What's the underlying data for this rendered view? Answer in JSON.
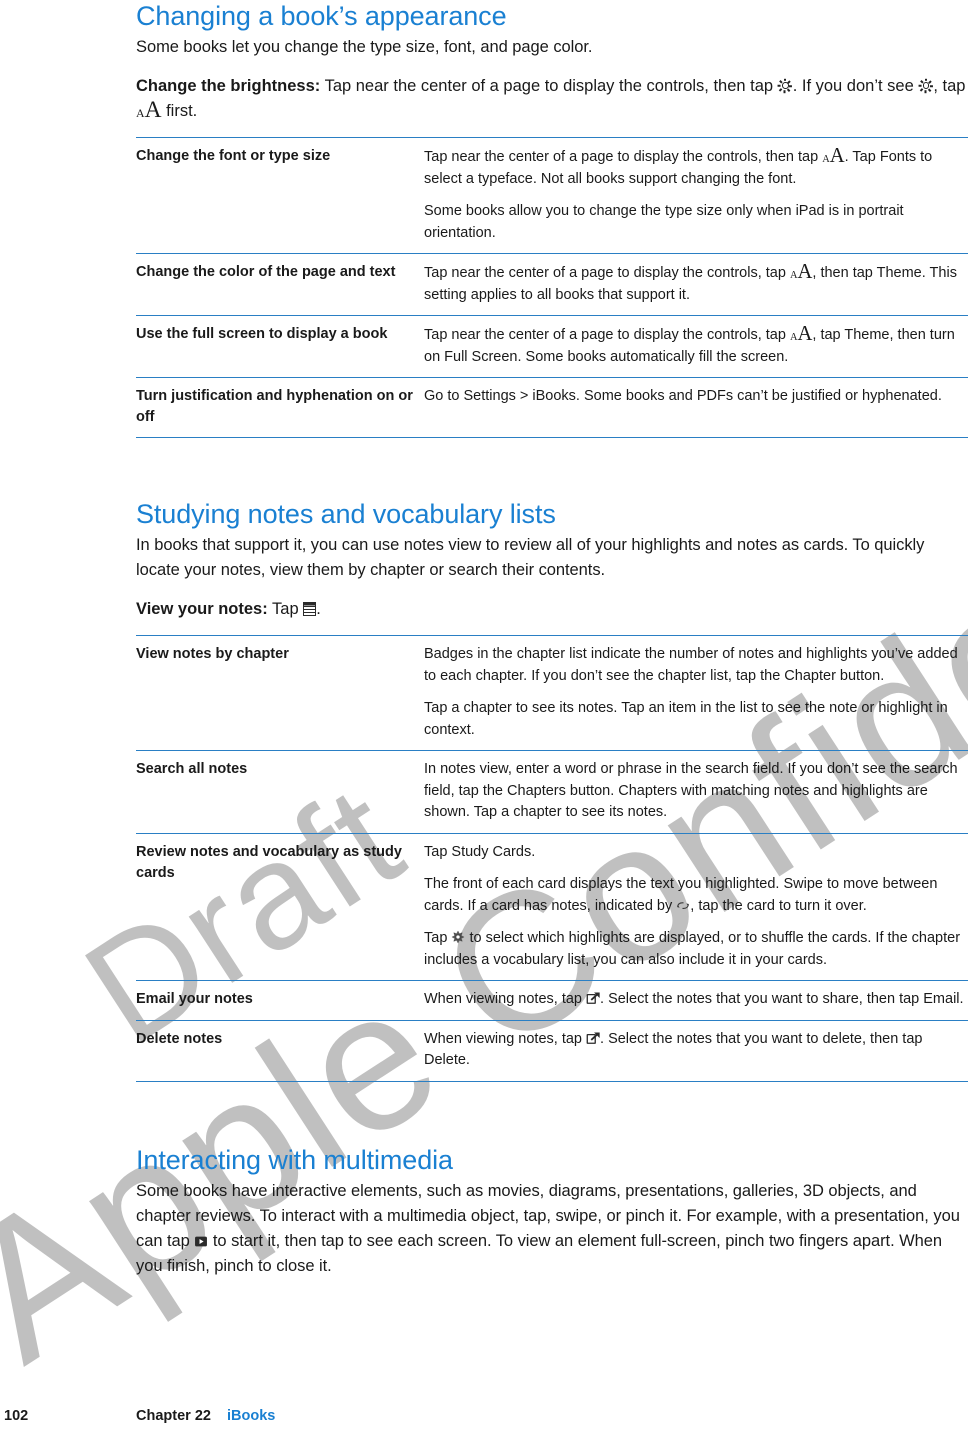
{
  "watermarks": {
    "primary": "Apple Confidential",
    "secondary": "Draft"
  },
  "colors": {
    "heading_blue": "#1a80d2",
    "rule_blue": "#2a7fc4",
    "body_text": "#1a1a1a",
    "watermark_gray": "#a9a9a9"
  },
  "sections": {
    "appearance": {
      "title": "Changing a book’s appearance",
      "intro": "Some books let you change the type size, font, and page color.",
      "task": {
        "label": "Change the brightness:",
        "text_before_sun": "Tap near the center of a page to display the controls, then tap",
        "text_middle": ". If you don’t see",
        "text_after_sun": ", tap",
        "text_end": "first."
      },
      "table": [
        {
          "label": "Change the font or type size",
          "paragraphs": [
            {
              "before": "Tap near the center of a page to display the controls, then tap",
              "icon": "aa-icon",
              "after": ". Tap Fonts to select a typeface. Not all books support changing the font."
            },
            {
              "before": "Some books allow you to change the type size only when iPad is in portrait orientation.",
              "icon": null,
              "after": ""
            }
          ]
        },
        {
          "label": "Change the color of the page and text",
          "paragraphs": [
            {
              "before": "Tap near the center of a page to display the controls, tap",
              "icon": "aa-icon",
              "after": ", then tap Theme. This setting applies to all books that support it."
            }
          ]
        },
        {
          "label": "Use the full screen to display a book",
          "paragraphs": [
            {
              "before": "Tap near the center of a page to display the controls, tap",
              "icon": "aa-icon",
              "after": ", tap Theme, then turn on Full Screen. Some books automatically fill the screen."
            }
          ]
        },
        {
          "label": "Turn justification and hyphenation on or off",
          "paragraphs": [
            {
              "before": "Go to Settings > iBooks. Some books and PDFs can’t be justified or hyphenated.",
              "icon": null,
              "after": ""
            }
          ]
        }
      ]
    },
    "notes": {
      "title": "Studying notes and vocabulary lists",
      "intro": "In books that support it, you can use notes view to review all of your highlights and notes as cards. To quickly locate your notes, view them by chapter or search their contents.",
      "task": {
        "label": "View your notes:",
        "text_before_icon": "Tap",
        "text_after_icon": "."
      },
      "table": [
        {
          "label": "View notes by chapter",
          "paragraphs": [
            {
              "before": "Badges in the chapter list indicate the number of notes and highlights you’ve added to each chapter. If you don’t see the chapter list, tap the Chapter button.",
              "icon": null,
              "after": ""
            },
            {
              "before": "Tap a chapter to see its notes. Tap an item in the list to see the note or highlight in context.",
              "icon": null,
              "after": ""
            }
          ]
        },
        {
          "label": "Search all notes",
          "paragraphs": [
            {
              "before": "In notes view, enter a word or phrase in the search field. If you don’t see the search field, tap the Chapters button. Chapters with matching notes and highlights are shown. Tap a chapter to see its notes.",
              "icon": null,
              "after": ""
            }
          ]
        },
        {
          "label": "Review notes and vocabulary as study cards",
          "paragraphs": [
            {
              "before": "Tap Study Cards.",
              "icon": null,
              "after": ""
            },
            {
              "before": "The front of each card displays the text you highlighted. Swipe to move between cards. If a card has notes, indicated by",
              "icon": "flip-icon",
              "after": ", tap the card to turn it over."
            },
            {
              "before": "Tap",
              "icon": "gear-icon",
              "after": "to select which highlights are displayed, or to shuffle the cards. If the chapter includes a vocabulary list, you can also include it in your cards."
            }
          ]
        },
        {
          "label": "Email your notes",
          "paragraphs": [
            {
              "before": "When viewing notes, tap",
              "icon": "share-icon",
              "after": ". Select the notes that you want to share, then tap Email."
            }
          ]
        },
        {
          "label": "Delete notes",
          "paragraphs": [
            {
              "before": "When viewing notes, tap",
              "icon": "share-icon",
              "after": ". Select the notes that you want to delete, then tap Delete."
            }
          ]
        }
      ]
    },
    "multimedia": {
      "title": "Interacting with multimedia",
      "body_before_icon": "Some books have interactive elements, such as movies, diagrams, presentations, galleries, 3D objects, and chapter reviews. To interact with a multimedia object, tap, swipe, or pinch it. For example, with a presentation, you can tap",
      "body_after_icon": "to start it, then tap to see each screen. To view an element full-screen, pinch two fingers apart. When you finish, pinch to close it."
    }
  },
  "footer": {
    "page_number": "102",
    "chapter_label": "Chapter 22",
    "chapter_title": "iBooks"
  }
}
